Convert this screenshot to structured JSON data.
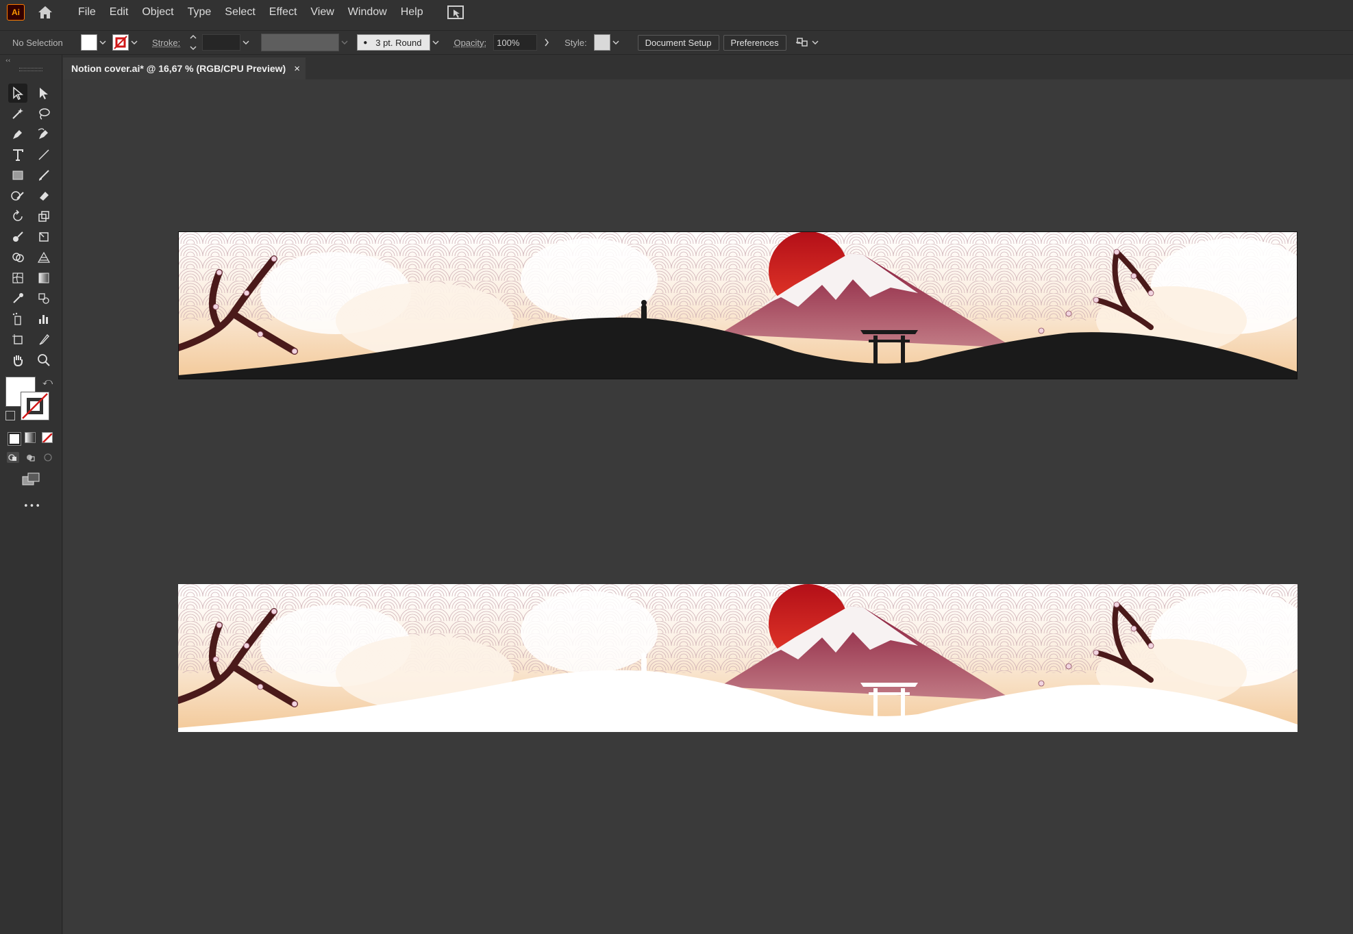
{
  "app": {
    "logo_text": "Ai"
  },
  "menu": [
    "File",
    "Edit",
    "Object",
    "Type",
    "Select",
    "Effect",
    "View",
    "Window",
    "Help"
  ],
  "control_bar": {
    "selection_label": "No Selection",
    "stroke_label": "Stroke:",
    "brush_label": "3 pt. Round",
    "opacity_label": "Opacity:",
    "opacity_value": "100%",
    "style_label": "Style:",
    "document_setup_label": "Document Setup",
    "preferences_label": "Preferences"
  },
  "document_tab": {
    "title": "Notion cover.ai* @ 16,67 % (RGB/CPU Preview)",
    "close_glyph": "×"
  },
  "colors": {
    "sun_red": "#c8161d",
    "mountain_maroon": "#7a1f3a",
    "hill_dark": "#1a1a1a",
    "hill_white": "#ffffff",
    "sky_peach": "#f4d3a8",
    "branch_brown": "#4a1a1a",
    "blossom_pink": "#f1d4e0"
  },
  "tools_more_label": "•••",
  "artboards": [
    {
      "variant": "dark-hills"
    },
    {
      "variant": "white-hills"
    }
  ]
}
